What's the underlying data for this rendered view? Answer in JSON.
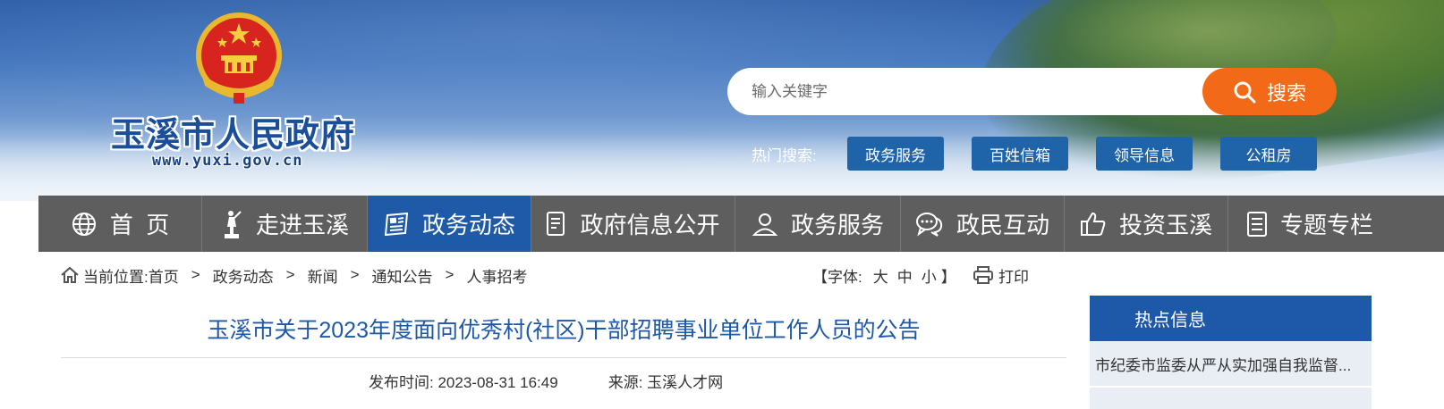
{
  "header": {
    "site_title": "玉溪市人民政府",
    "site_url": "www.yuxi.gov.cn",
    "search": {
      "placeholder": "输入关键字",
      "button_label": "搜索"
    },
    "hot_search": {
      "label": "热门搜索:",
      "tags": [
        "政务服务",
        "百姓信箱",
        "领导信息",
        "公租房"
      ]
    },
    "colors": {
      "brand_blue": "#1e58a8",
      "search_orange": "#f26a17",
      "nav_gray": "#5e5e5e"
    }
  },
  "nav": {
    "items": [
      {
        "label": "首  页",
        "icon": "globe-icon"
      },
      {
        "label": "走进玉溪",
        "icon": "statue-icon"
      },
      {
        "label": "政务动态",
        "icon": "newspaper-icon",
        "active": true
      },
      {
        "label": "政府信息公开",
        "icon": "document-list-icon"
      },
      {
        "label": "政务服务",
        "icon": "user-icon"
      },
      {
        "label": "政民互动",
        "icon": "chat-bubbles-icon"
      },
      {
        "label": "投资玉溪",
        "icon": "thumbs-up-icon"
      },
      {
        "label": "专题专栏",
        "icon": "list-doc-icon"
      }
    ]
  },
  "breadcrumb": {
    "label": "当前位置:",
    "items": [
      "首页",
      "政务动态",
      "新闻",
      "通知公告",
      "人事招考"
    ],
    "separator": ">"
  },
  "font_size": {
    "prefix": "【字体:",
    "options": [
      "大",
      "中",
      "小"
    ],
    "suffix": "】"
  },
  "print_label": "打印",
  "article": {
    "title": "玉溪市关于2023年度面向优秀村(社区)干部招聘事业单位工作人员的公告",
    "publish_label": "发布时间:",
    "publish_time": "2023-08-31 16:49",
    "source_label": "来源:",
    "source": "玉溪人才网"
  },
  "sidebar": {
    "title": "热点信息",
    "items": [
      "市纪委市监委从严从实加强自我监督..."
    ]
  }
}
